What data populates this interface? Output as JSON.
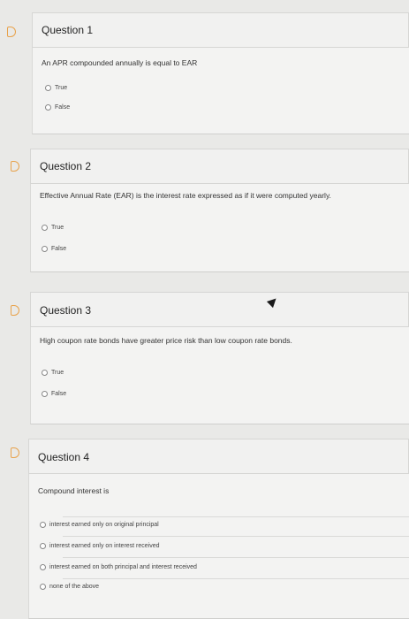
{
  "questions": [
    {
      "title": "Question 1",
      "text": "An APR compounded annually is equal to EAR",
      "options": [
        "True",
        "False"
      ]
    },
    {
      "title": "Question 2",
      "text": "Effective Annual Rate (EAR) is the interest rate expressed as if it were computed yearly.",
      "options": [
        "True",
        "False"
      ]
    },
    {
      "title": "Question 3",
      "text": "High coupon rate bonds have greater price risk than low coupon rate bonds.",
      "options": [
        "True",
        "False"
      ]
    },
    {
      "title": "Question 4",
      "text": "Compound interest is",
      "options": [
        "interest earned only on original principal",
        "interest earned only on interest received",
        "interest earned on both principal and interest received",
        "none of the above"
      ]
    }
  ],
  "colors": {
    "flag": "#e8a24b",
    "background": "#e9e9e7"
  }
}
